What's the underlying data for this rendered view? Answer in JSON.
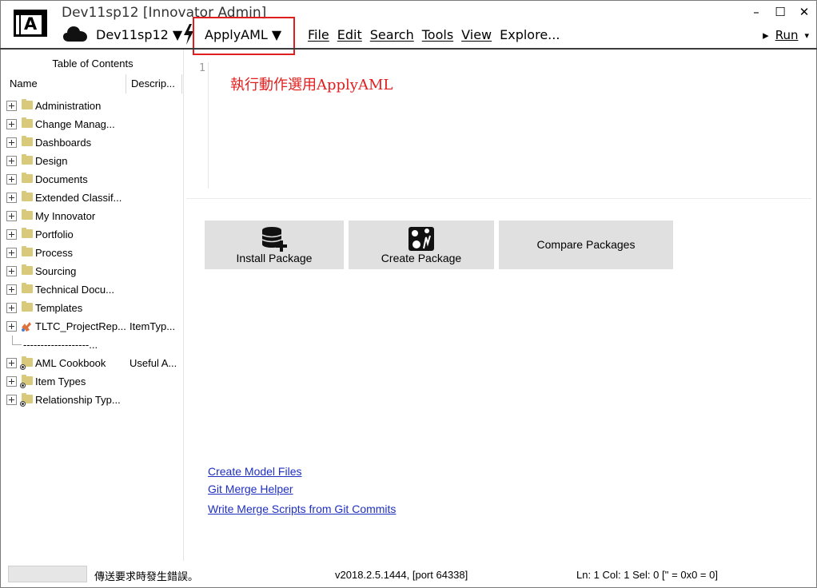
{
  "window": {
    "title": "Dev11sp12 [Innovator Admin]",
    "controls": {
      "minimize": "–",
      "maximize": "☐",
      "close": "✕"
    }
  },
  "logo": {
    "letter": "A"
  },
  "toolbar": {
    "database": "Dev11sp12 ▼",
    "action": "ApplyAML ▼",
    "menu": [
      "File",
      "Edit",
      "Search",
      "Tools",
      "View",
      "Explore..."
    ],
    "run_arrow": "▸",
    "run_label": "Run",
    "run_dropdown": "▾"
  },
  "left_panel": {
    "title": "Table of Contents",
    "columns": {
      "name": "Name",
      "description": "Descrip..."
    },
    "items": [
      {
        "label": "Administration",
        "desc": ""
      },
      {
        "label": "Change Manag...",
        "desc": ""
      },
      {
        "label": "Dashboards",
        "desc": ""
      },
      {
        "label": "Design",
        "desc": ""
      },
      {
        "label": "Documents",
        "desc": ""
      },
      {
        "label": "Extended Classif...",
        "desc": ""
      },
      {
        "label": "My Innovator",
        "desc": ""
      },
      {
        "label": "Portfolio",
        "desc": ""
      },
      {
        "label": "Process",
        "desc": ""
      },
      {
        "label": "Sourcing",
        "desc": ""
      },
      {
        "label": "Technical Docu...",
        "desc": ""
      },
      {
        "label": "Templates",
        "desc": ""
      },
      {
        "label": "TLTC_ProjectRep...",
        "desc": "ItemTyp..."
      },
      {
        "label": "-------------------...",
        "desc": ""
      },
      {
        "label": "AML Cookbook",
        "desc": "Useful A..."
      },
      {
        "label": "Item Types",
        "desc": ""
      },
      {
        "label": "Relationship Typ...",
        "desc": ""
      }
    ]
  },
  "editor": {
    "line_number": "1",
    "content": "執行動作選用ApplyAML"
  },
  "packages": {
    "install": "Install Package",
    "create": "Create Package",
    "compare": "Compare Packages"
  },
  "links": {
    "create_model": "Create Model Files",
    "git_merge": "Git Merge Helper",
    "write_merge": "Write Merge Scripts from Git Commits"
  },
  "status": {
    "message": "傳送要求時發生錯誤。",
    "version": "v2018.2.5.1444, [port 64338]",
    "position": "Ln: 1  Col: 1  Sel: 0 ['' = 0x0 = 0]"
  },
  "colors": {
    "highlight": "#e01e1e",
    "link": "#1f2fc2",
    "folder": "#d9c97a",
    "button": "#e0e0e0"
  }
}
